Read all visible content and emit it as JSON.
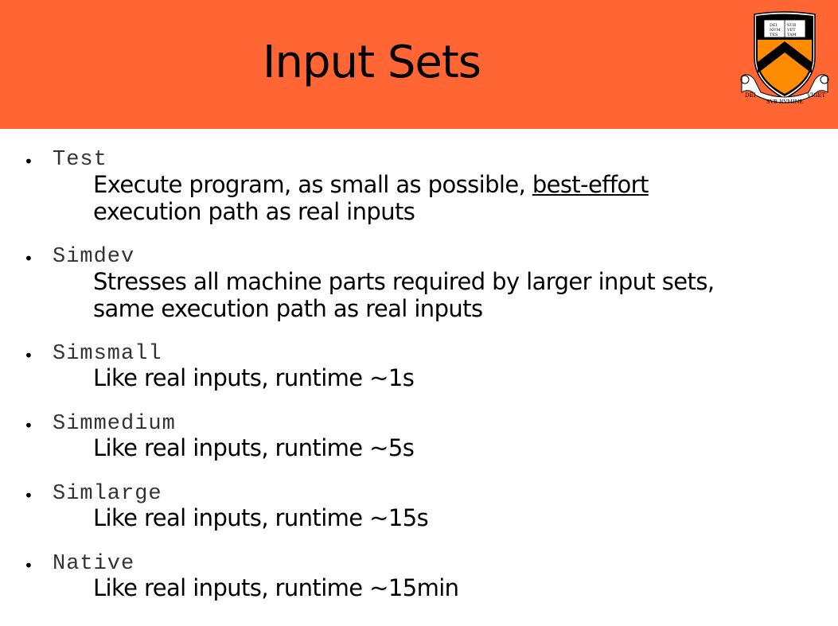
{
  "slide": {
    "title": "Input Sets",
    "logo": {
      "book_text": [
        "DEI",
        "SUB",
        "NUM",
        "VET",
        "TES",
        "TAM",
        "ENTUM"
      ],
      "motto": [
        "DEI",
        "SVB NVMINE",
        "VIGET"
      ],
      "colors": {
        "shield_orange": "#ff8c00",
        "shield_black": "#000000"
      }
    },
    "header_color": "#ff6633",
    "items": [
      {
        "term": "Test",
        "desc_line1_pre": "Execute program, as small as possible, ",
        "desc_line1_link": "best-effort",
        "desc_line2": "execution path as real inputs"
      },
      {
        "term": "Simdev",
        "desc_line1": "Stresses all machine parts required by larger input sets,",
        "desc_line2": "same execution path as real inputs"
      },
      {
        "term": "Simsmall",
        "desc": "Like real inputs, runtime ~1s"
      },
      {
        "term": "Simmedium",
        "desc": "Like real inputs, runtime ~5s"
      },
      {
        "term": "Simlarge",
        "desc": "Like real inputs, runtime ~15s"
      },
      {
        "term": "Native",
        "desc": "Like real inputs, runtime ~15min"
      }
    ]
  }
}
